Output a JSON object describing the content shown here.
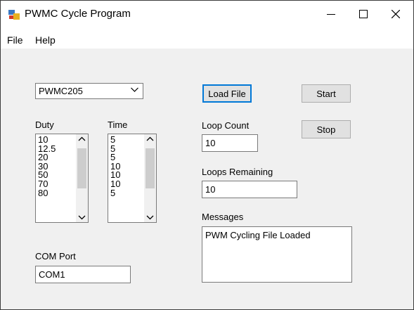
{
  "window": {
    "title": "PWMC Cycle Program"
  },
  "menu": [
    "File",
    "Help"
  ],
  "device_combo": {
    "value": "PWMC205"
  },
  "duty": {
    "label": "Duty",
    "items": [
      "10",
      "12.5",
      "20",
      "30",
      "50",
      "70",
      "80"
    ]
  },
  "time": {
    "label": "Time",
    "items": [
      "5",
      "5",
      "5",
      "10",
      "10",
      "10",
      "5"
    ]
  },
  "buttons": {
    "load": "Load File",
    "start": "Start",
    "stop": "Stop"
  },
  "loop_count": {
    "label": "Loop Count",
    "value": "10"
  },
  "loops_remaining": {
    "label": "Loops Remaining",
    "value": "10"
  },
  "messages": {
    "label": "Messages",
    "text": "PWM Cycling File Loaded"
  },
  "com_port": {
    "label": "COM Port",
    "value": "COM1"
  }
}
